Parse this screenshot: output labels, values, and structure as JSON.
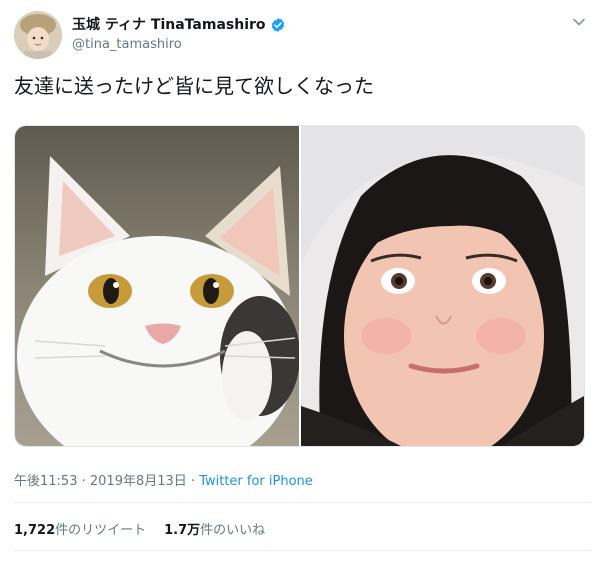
{
  "author": {
    "display_name": "玉城 ティナ TinaTamashiro",
    "handle": "@tina_tamashiro",
    "verified": true,
    "avatar_icon": "avatar-photo"
  },
  "tweet": {
    "text": "友達に送ったけど皆に見て欲しくなった",
    "time": "午後11:53",
    "sep1": " · ",
    "date": "2019年8月13日",
    "sep2": " · ",
    "source": "Twitter for iPhone"
  },
  "media": {
    "left_icon": "cat-photo",
    "right_icon": "face-photo"
  },
  "stats": {
    "retweets_count": "1,722",
    "retweets_label": "件のリツイート",
    "likes_count": "1.7万",
    "likes_label": "件のいいね"
  },
  "colors": {
    "accent": "#1b95e0",
    "verified": "#1da1f2",
    "muted": "#657786",
    "text": "#14171a"
  }
}
